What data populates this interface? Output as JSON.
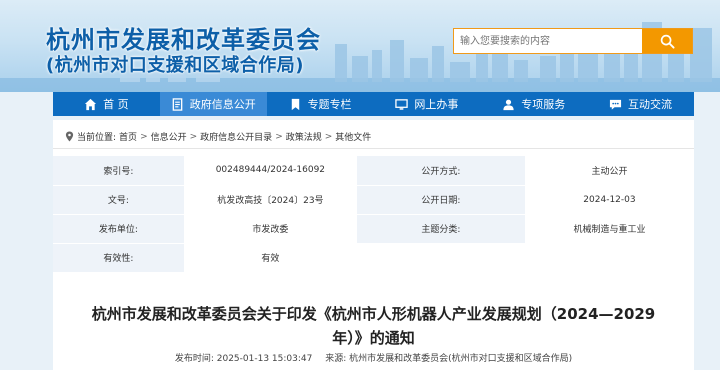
{
  "header": {
    "title": "杭州市发展和改革委员会",
    "subtitle": "(杭州市对口支援和区域合作局)",
    "search_placeholder": "输入您要搜索的内容",
    "search_icon": "search-icon"
  },
  "nav": [
    {
      "label": "首  页",
      "icon": "home-icon"
    },
    {
      "label": "政府信息公开",
      "icon": "document-icon",
      "active": true
    },
    {
      "label": "专题专栏",
      "icon": "bookmark-icon"
    },
    {
      "label": "网上办事",
      "icon": "monitor-icon"
    },
    {
      "label": "专项服务",
      "icon": "service-icon"
    },
    {
      "label": "互动交流",
      "icon": "chat-icon"
    }
  ],
  "breadcrumb": {
    "icon": "location-icon",
    "prefix": "当前位置:",
    "items": [
      "首页",
      "信息公开",
      "政府信息公开目录",
      "政策法规",
      "其他文件"
    ],
    "separator": ">"
  },
  "meta": {
    "rows": [
      {
        "k1": "索引号:",
        "v1": "002489444/2024-16092",
        "k2": "公开方式:",
        "v2": "主动公开"
      },
      {
        "k1": "文号:",
        "v1": "杭发改高技〔2024〕23号",
        "k2": "公开日期:",
        "v2": "2024-12-03"
      },
      {
        "k1": "发布单位:",
        "v1": "市发改委",
        "k2": "主题分类:",
        "v2": "机械制造与重工业"
      },
      {
        "k1": "有效性:",
        "v1": "有效",
        "k2": "",
        "v2": ""
      }
    ]
  },
  "article": {
    "title_line1": "杭州市发展和改革委员会关于印发《杭州市人形机器人产业发展规划（2024—2029",
    "title_line2": "年）》的通知",
    "publish_time": "发布时间: 2025-01-13 15:03:47",
    "source": "来源: 杭州市发展和改革委员会(杭州市对口支援和区域合作局)"
  },
  "colors": {
    "brand_blue": "#0d6cc0",
    "title_blue": "#0d5fa8",
    "search_orange": "#f39800"
  }
}
